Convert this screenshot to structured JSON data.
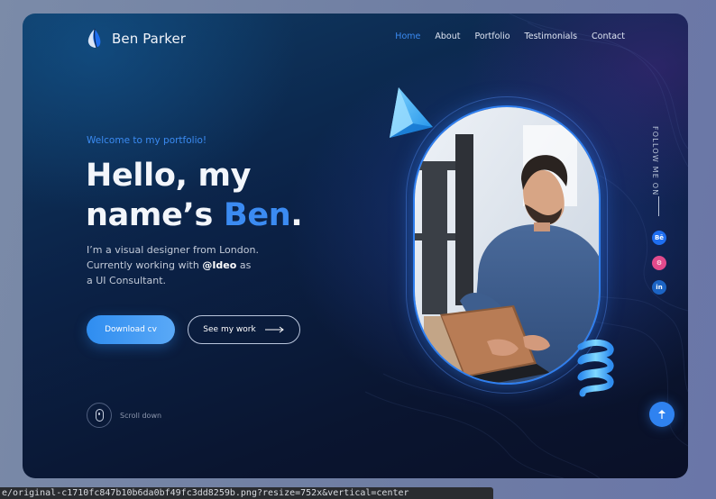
{
  "brand": {
    "name": "Ben Parker",
    "logo_icon": "leaf-drop-icon"
  },
  "nav": {
    "items": [
      {
        "label": "Home",
        "active": true
      },
      {
        "label": "About",
        "active": false
      },
      {
        "label": "Portfolio",
        "active": false
      },
      {
        "label": "Testimonials",
        "active": false
      },
      {
        "label": "Contact",
        "active": false
      }
    ]
  },
  "hero": {
    "welcome": "Welcome to my portfolio!",
    "headline_line1": "Hello, my",
    "headline_line2_prefix": "name’s ",
    "headline_name": "Ben",
    "headline_suffix": ".",
    "description_line1": "I’m a visual designer from London.",
    "description_line2_prefix": "Currently working with ",
    "description_company": "@Ideo",
    "description_line2_suffix": " as",
    "description_line3": "a UI Consultant.",
    "primary_button": "Download cv",
    "secondary_button": "See my work",
    "scroll_label": "Scroll down"
  },
  "social": {
    "label": "FOLLOW ME ON",
    "links": [
      {
        "name": "Behance",
        "text": "Bē",
        "color": "#1f6ef0"
      },
      {
        "name": "Dribbble",
        "text": "⚙",
        "color": "#e14b8c"
      },
      {
        "name": "LinkedIn",
        "text": "in",
        "color": "#1c64c4"
      }
    ]
  },
  "colors": {
    "accent": "#3b8bf2",
    "background": "#0b2247",
    "text": "#f3f6fb"
  },
  "url_bar": {
    "text": "e/original-c1710fc847b10b6da0bf49fc3dd8259b.png?resize=752x&vertical=center"
  }
}
